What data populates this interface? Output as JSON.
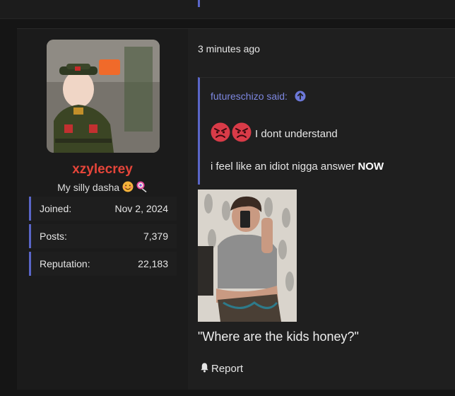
{
  "post": {
    "user": {
      "username": "xzylecrey",
      "title_text": "My silly dasha",
      "title_emojis": [
        "blushing-face-emoji",
        "lollipop-emoji"
      ],
      "stats": [
        {
          "label": "Joined:",
          "value": "Nov 2, 2024"
        },
        {
          "label": "Posts:",
          "value": "7,379"
        },
        {
          "label": "Reputation:",
          "value": "22,183"
        }
      ],
      "username_color": "#e5453a"
    },
    "timestamp": "3 minutes ago",
    "quote": {
      "author_said": "futureschizo said:",
      "line1_emojis": [
        "angry-face-emoji",
        "angry-face-emoji"
      ],
      "line1_text": "I dont understand",
      "line2_prefix": "i feel like an idiot nigga answer ",
      "line2_bold": "NOW",
      "accent_color": "#5a66c8"
    },
    "message": "\"Where are the kids honey?\"",
    "report_label": "Report"
  }
}
